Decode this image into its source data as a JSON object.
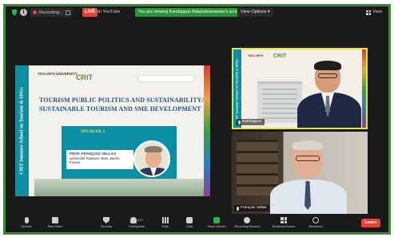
{
  "topbar": {
    "recording_label": "Recording...",
    "live_label": "LIVE",
    "live_platform": "on YouTube",
    "viewing_banner": "You are viewing Kandappan Balasubramanian's screen",
    "view_options_label": "View Options",
    "view_label": "View"
  },
  "slide": {
    "side_text": "CRiT Summer School on Tourism & SDGs",
    "university": "TAYLOR'S UNIVERSITY",
    "crit_logo": "CRiT",
    "title": "TOURISM PUBLIC POLITICS AND SUSTAINABILITY/ SUSTAINABLE TOURISM AND SME DEVELOPMENT",
    "speaker_tag": "SPEAKER 2",
    "speaker_name": "PROF. FRANÇOIS VELLAS",
    "speaker_affiliation": "Université Toulouse-Jean Jaurès, France"
  },
  "tiles": [
    {
      "side_text": "CRiT Summer School on Tourism & SDGs",
      "crit_logo": "CRiT",
      "name": "Kandappan"
    },
    {
      "name": "François Vellas"
    }
  ],
  "toolbar": {
    "items": [
      "Unmute",
      "Start Video",
      "Security",
      "Participants",
      "Polls",
      "Chat",
      "Share Screen",
      "Recording Paused",
      "Breakout Rooms",
      "Reactions"
    ],
    "participants_count": "472",
    "leave_label": "Leave"
  },
  "colors": {
    "frame_border": "#3e8a34",
    "banner_green": "#2f8f3c",
    "live_red": "#e0453b",
    "slide_teal": "#0b8fa3",
    "title_blue": "#1f4f86",
    "active_speaker": "#e8e33a"
  }
}
